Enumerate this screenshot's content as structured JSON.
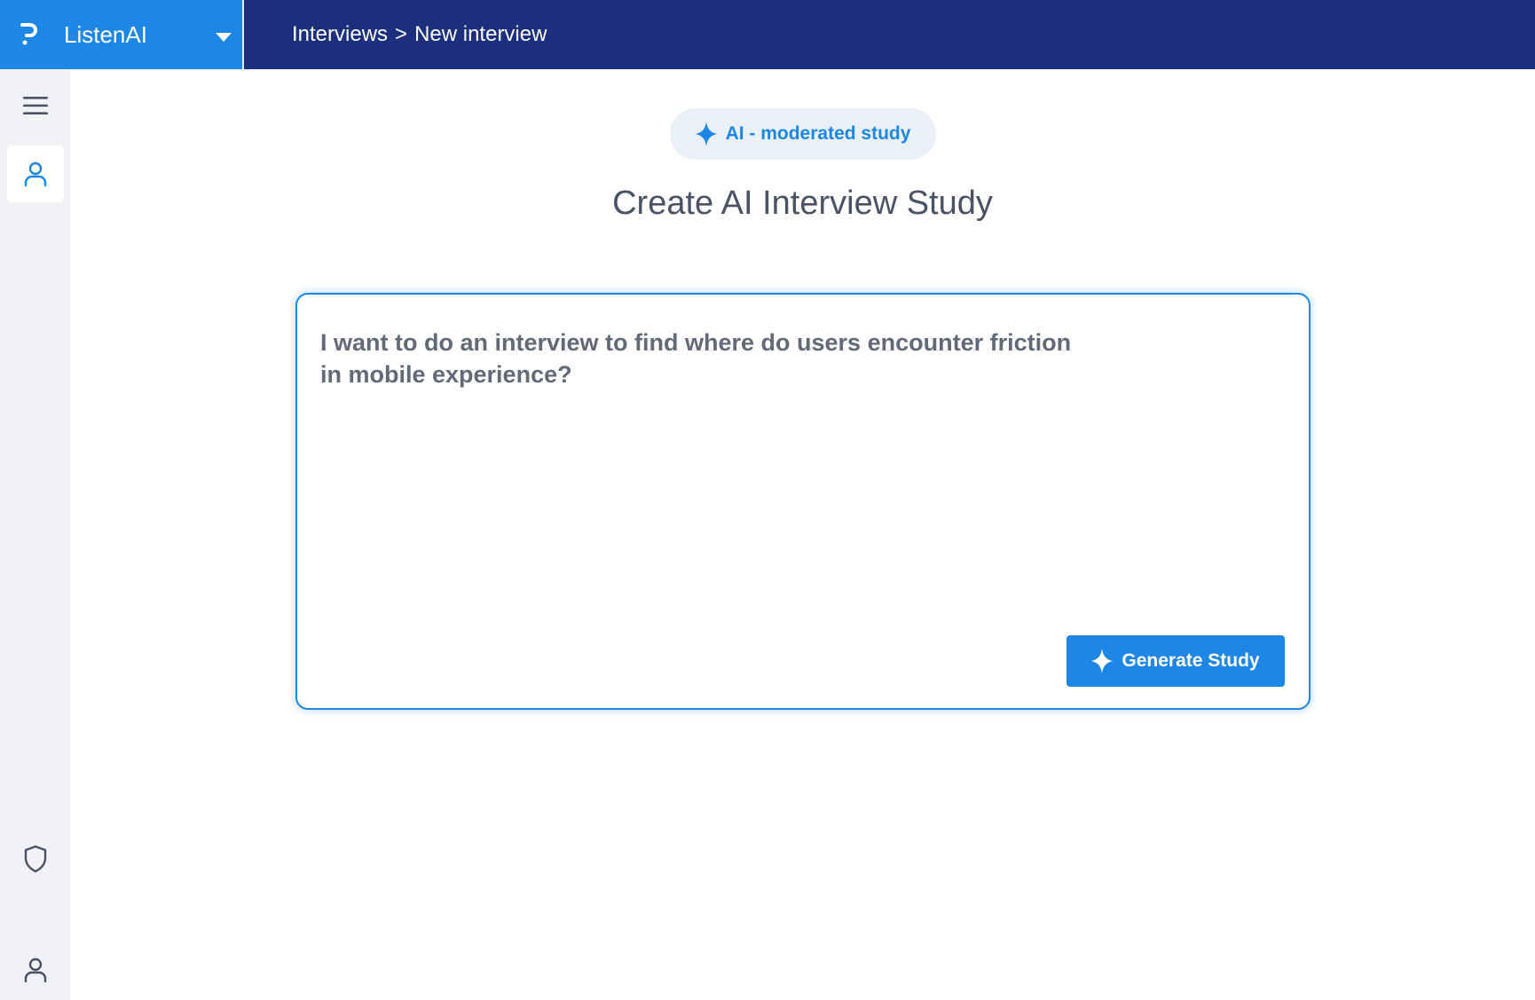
{
  "app": {
    "name": "ListenAI",
    "logo_icon": "brand-p-logo",
    "switcher_icon": "caret-down-icon"
  },
  "breadcrumb": {
    "items": [
      "Interviews",
      "New interview"
    ],
    "separator": ">"
  },
  "sidebar": {
    "top_items": [
      {
        "icon": "menu-icon",
        "label": "Menu"
      },
      {
        "icon": "user-icon",
        "label": "Interviews",
        "active": true
      }
    ],
    "bottom_items": [
      {
        "icon": "shield-icon",
        "label": "Security"
      },
      {
        "icon": "user-icon",
        "label": "Account"
      }
    ]
  },
  "main": {
    "badge": {
      "icon": "sparkle-icon",
      "label": "AI - moderated study"
    },
    "title": "Create AI Interview Study",
    "prompt": {
      "value": "I want to do an interview to find where do users encounter friction\nin mobile experience?",
      "placeholder": ""
    },
    "generate_button": {
      "icon": "sparkle-icon",
      "label": "Generate Study"
    }
  },
  "colors": {
    "topbar": "#1b2f7c",
    "brand": "#1e86e5",
    "accent": "#1e86e5",
    "sidebar_bg": "#f1f2f6",
    "title_text": "#4a5266"
  }
}
